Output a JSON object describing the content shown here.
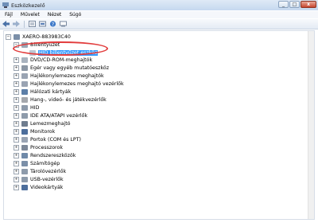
{
  "window": {
    "title": "Eszközkezelő"
  },
  "menu": [
    "Fájl",
    "Művelet",
    "Nézet",
    "Súgó"
  ],
  "toolbar": [
    "back-icon",
    "forward-icon",
    "properties-icon",
    "show-hidden-icon",
    "help-icon",
    "scan-hardware-icon"
  ],
  "tree": {
    "root": "XAERO-883983C40",
    "children": [
      "Billentyűzet",
      "HID billentyűzet eszköz",
      "DVD/CD-ROM-meghajtók",
      "Egér vagy egyéb mutatóeszköz",
      "Hajlékonylemezes meghajtók",
      "Hajlékonylemezes meghajtó vezérlők",
      "Hálózati kártyák",
      "Hang-, videó- és játékvezérlők",
      "HID",
      "IDE ATA/ATAPI vezérlők",
      "Lemezmeghajtó",
      "Monitorok",
      "Portok (COM és LPT)",
      "Processzorok",
      "Rendszereszközök",
      "Számítógép",
      "Tárolóvezérlők",
      "USB-vezérlők",
      "Videokártyák"
    ]
  },
  "colors": {
    "selection": "#3399ff",
    "annotation_circle": "#e23c3c"
  }
}
